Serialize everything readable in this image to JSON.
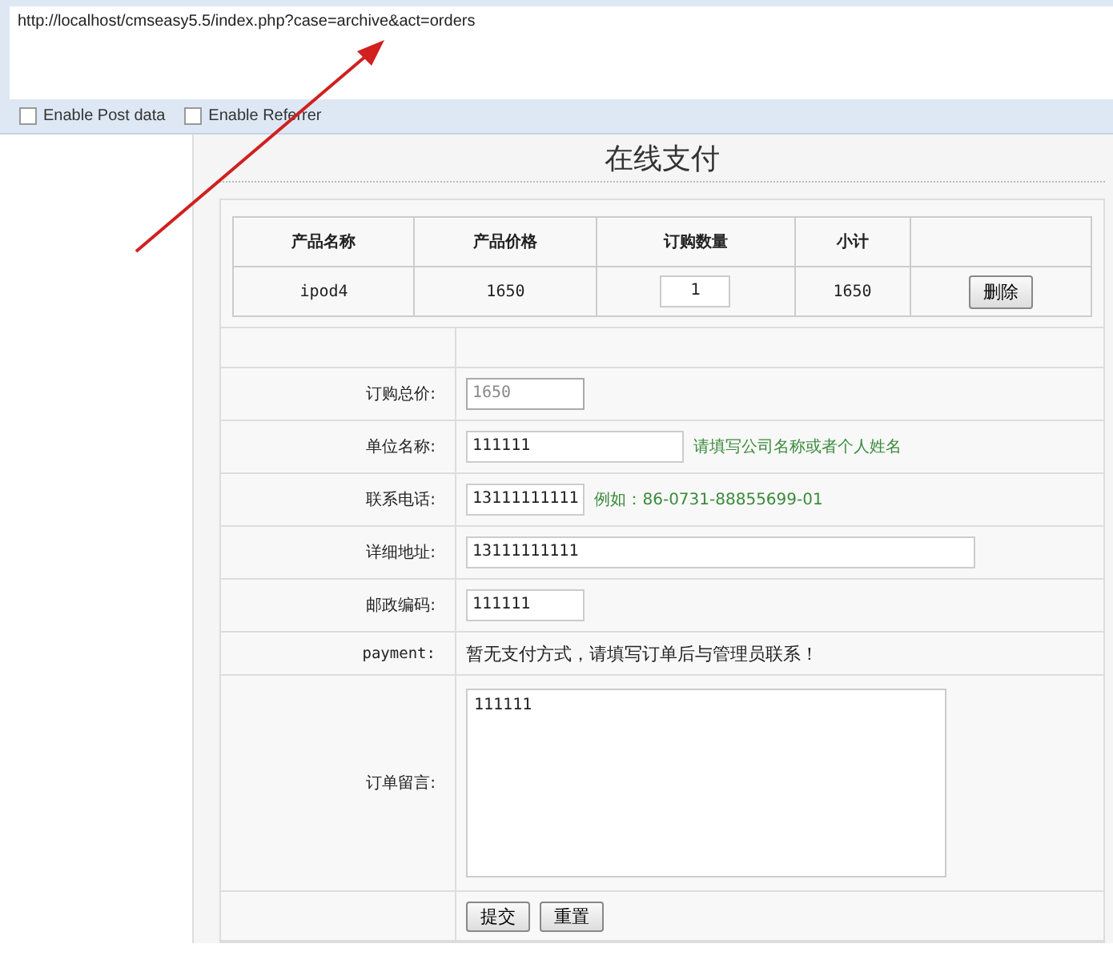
{
  "request_panel": {
    "url": "http://localhost/cmseasy5.5/index.php?case=archive&act=orders",
    "options": [
      {
        "label": "Enable Post data",
        "checked": false
      },
      {
        "label": "Enable Referrer",
        "checked": false
      }
    ]
  },
  "page": {
    "title": "在线支付",
    "cart": {
      "columns": [
        "产品名称",
        "产品价格",
        "订购数量",
        "小计"
      ],
      "rows": [
        {
          "name": "ipod4",
          "price": "1650",
          "quantity": "1",
          "subtotal": "1650",
          "action": "删除"
        }
      ]
    },
    "form": [
      {
        "kind": "blank"
      },
      {
        "kind": "input",
        "label": "订购总价:",
        "value": "1650",
        "disabled": true
      },
      {
        "kind": "input",
        "label": "单位名称:",
        "value": "111111",
        "disabled": false,
        "hint": "请填写公司名称或者个人姓名"
      },
      {
        "kind": "input",
        "label": "联系电话:",
        "value": "13111111111",
        "disabled": false,
        "hint": "例如：86-0731-88855699-01"
      },
      {
        "kind": "input",
        "label": "详细地址:",
        "value": "13111111111",
        "disabled": false
      },
      {
        "kind": "input",
        "label": "邮政编码:",
        "value": "111111",
        "disabled": false
      },
      {
        "kind": "text",
        "label": "payment:",
        "value": "暂无支付方式，请填写订单后与管理员联系！"
      },
      {
        "kind": "textarea",
        "label": "订单留言:",
        "value": "111111"
      },
      {
        "kind": "buttons",
        "buttons": [
          "提交",
          "重置"
        ]
      }
    ]
  }
}
